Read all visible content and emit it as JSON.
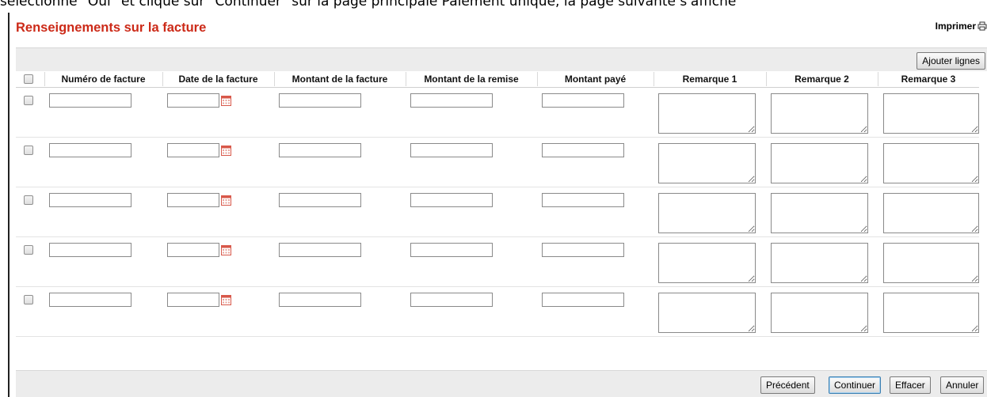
{
  "document_text": "sélectionné \"Oui\" et cliqué sur \"Continuer\" sur la page principale Paiement unique, la page suivante s'affiche",
  "page": {
    "title": "Renseignements sur la facture",
    "print_label": "Imprimer"
  },
  "toolbar": {
    "add_rows_label": "Ajouter lignes"
  },
  "table": {
    "columns": [
      "Numéro de facture",
      "Date de la facture",
      "Montant de la facture",
      "Montant de la remise",
      "Montant payé",
      "Remarque 1",
      "Remarque 2",
      "Remarque 3"
    ],
    "rows": [
      {
        "invoice_number": "",
        "invoice_date": "",
        "invoice_amount": "",
        "discount_amount": "",
        "amount_paid": "",
        "remark1": "",
        "remark2": "",
        "remark3": ""
      },
      {
        "invoice_number": "",
        "invoice_date": "",
        "invoice_amount": "",
        "discount_amount": "",
        "amount_paid": "",
        "remark1": "",
        "remark2": "",
        "remark3": ""
      },
      {
        "invoice_number": "",
        "invoice_date": "",
        "invoice_amount": "",
        "discount_amount": "",
        "amount_paid": "",
        "remark1": "",
        "remark2": "",
        "remark3": ""
      },
      {
        "invoice_number": "",
        "invoice_date": "",
        "invoice_amount": "",
        "discount_amount": "",
        "amount_paid": "",
        "remark1": "",
        "remark2": "",
        "remark3": ""
      },
      {
        "invoice_number": "",
        "invoice_date": "",
        "invoice_amount": "",
        "discount_amount": "",
        "amount_paid": "",
        "remark1": "",
        "remark2": "",
        "remark3": ""
      }
    ]
  },
  "footer": {
    "previous_label": "Précédent",
    "continue_label": "Continuer",
    "clear_label": "Effacer",
    "cancel_label": "Annuler"
  },
  "colors": {
    "title": "#cc2a18",
    "toolbar_bg": "#ececec",
    "calendar_icon": "#d8584a"
  },
  "icons": {
    "print": "printer-icon",
    "calendar": "calendar-icon"
  }
}
